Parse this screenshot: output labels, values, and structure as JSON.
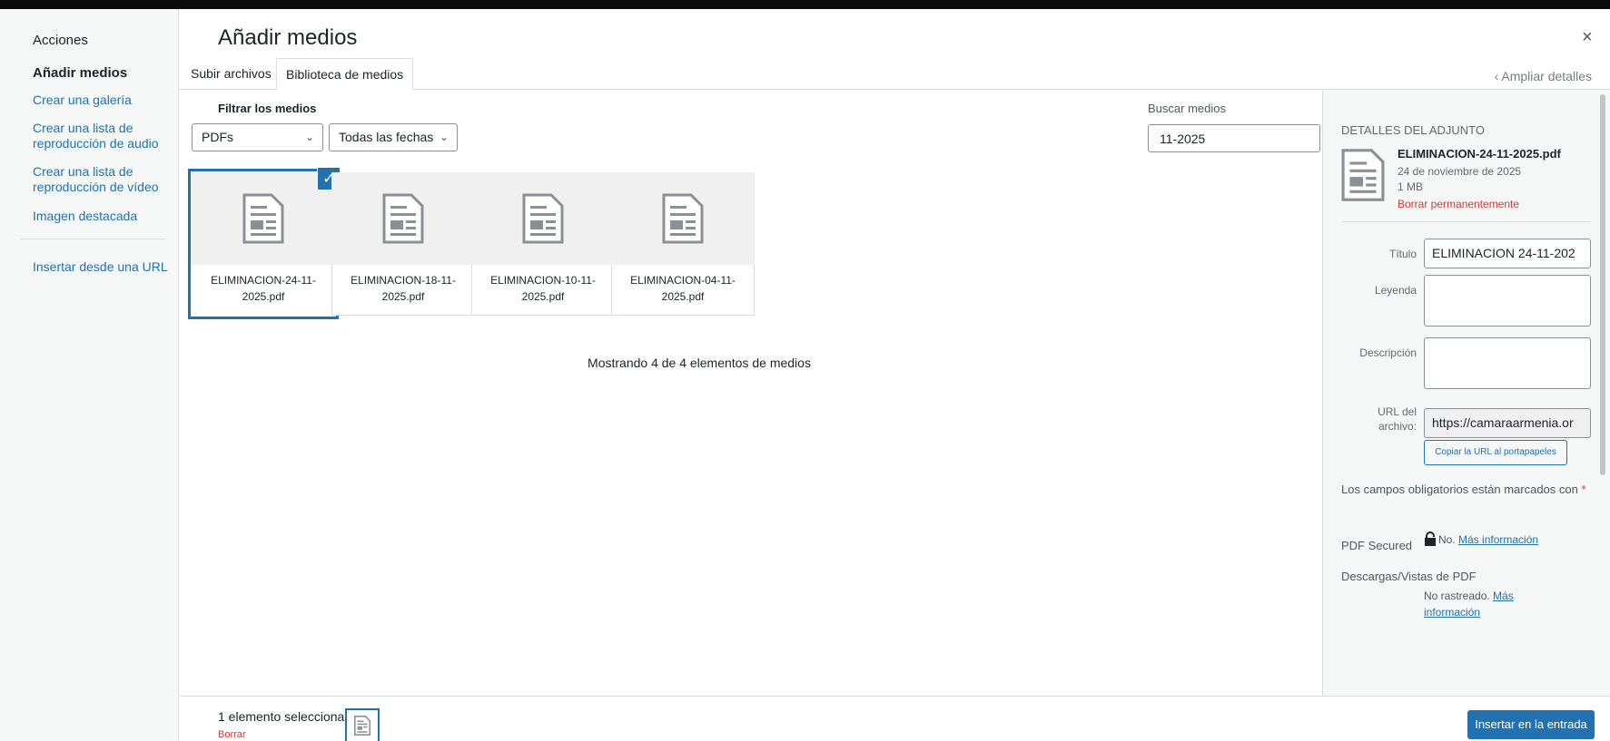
{
  "header": {
    "title": "Añadir medios",
    "close": "×"
  },
  "menu": {
    "heading": "Acciones",
    "items": [
      {
        "label": "Añadir medios",
        "active": true
      },
      {
        "label": "Crear una galería"
      },
      {
        "label": "Crear una lista de reproducción de audio"
      },
      {
        "label": "Crear una lista de reproducción de vídeo"
      },
      {
        "label": "Imagen destacada"
      },
      {
        "label": "Insertar desde una URL"
      }
    ]
  },
  "tabs": [
    {
      "label": "Subir archivos"
    },
    {
      "label": "Biblioteca de medios",
      "active": true
    }
  ],
  "expand_details": "‹ Ampliar detalles",
  "filters": {
    "label": "Filtrar los medios",
    "type_value": "PDFs",
    "date_value": "Todas las fechas",
    "search_label": "Buscar medios",
    "search_value": "11-2025"
  },
  "attachments": [
    {
      "name": "ELIMINACION-24-11-2025.pdf",
      "line1": "ELIMINACION-24-11-",
      "line2": "2025.pdf",
      "selected": true
    },
    {
      "name": "ELIMINACION-18-11-2025.pdf",
      "line1": "ELIMINACION-18-11-",
      "line2": "2025.pdf"
    },
    {
      "name": "ELIMINACION-10-11-2025.pdf",
      "line1": "ELIMINACION-10-11-",
      "line2": "2025.pdf"
    },
    {
      "name": "ELIMINACION-04-11-2025.pdf",
      "line1": "ELIMINACION-04-11-",
      "line2": "2025.pdf"
    }
  ],
  "showing": "Mostrando 4 de 4 elementos de medios",
  "details": {
    "heading": "DETALLES DEL ADJUNTO",
    "filename": "ELIMINACION-24-11-2025.pdf",
    "date": "24 de noviembre de 2025",
    "size": "1 MB",
    "delete": "Borrar permanentemente",
    "title_label": "Título",
    "title_value": "ELIMINACION 24-11-202",
    "caption_label": "Leyenda",
    "description_label": "Descripción",
    "url_label_1": "URL del",
    "url_label_2": "archivo:",
    "url_value": "https://camaraarmenia.or",
    "copy_button": "Copiar la URL al portapapeles",
    "required_note": "Los campos obligatorios están marcados con",
    "required_star": "*",
    "pdf_secured_label": "PDF Secured",
    "pdf_secured_value": "No.",
    "more_info": "Más información",
    "downloads_label": "Descargas/Vistas de PDF",
    "not_tracked": "No rastreado.",
    "more_info_short": "Más",
    "more_info_cut": "información"
  },
  "toolbar": {
    "selected_count": "1 elemento seleccionado",
    "clear": "Borrar",
    "insert": "Insertar en la entrada"
  },
  "colors": {
    "accent": "#2271b1",
    "danger": "#d63638",
    "panel": "#f6f7f7"
  }
}
